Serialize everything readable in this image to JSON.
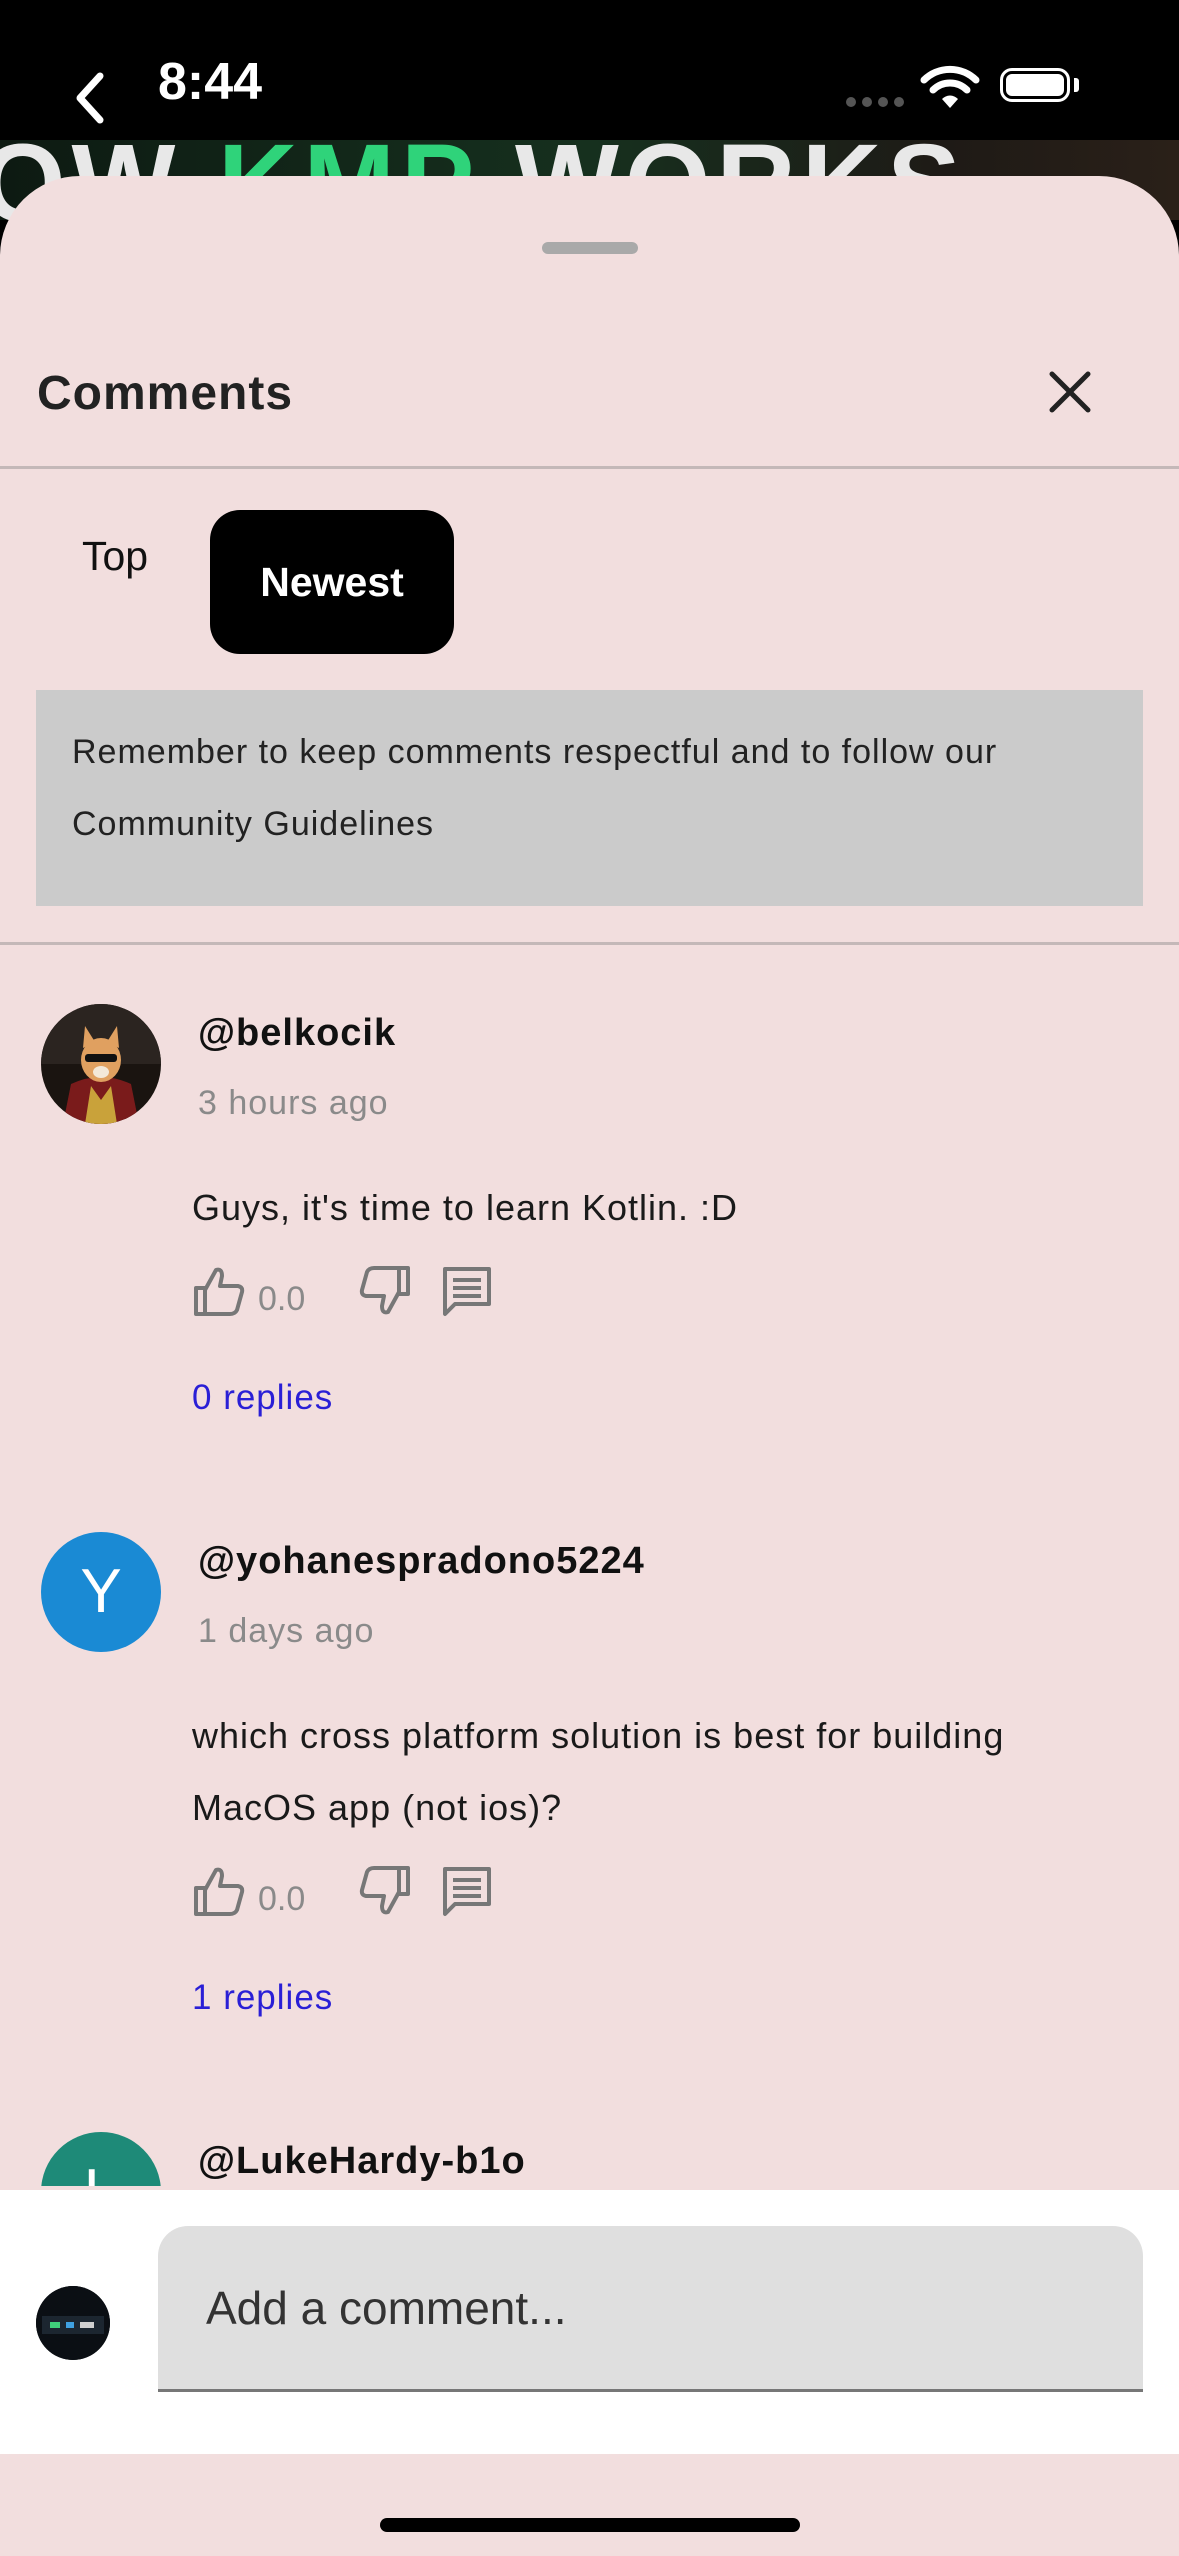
{
  "status_bar": {
    "time": "8:44"
  },
  "thumbnail": {
    "text_white_1": "OW ",
    "text_green": "KMP",
    "text_white_2": " WORKS"
  },
  "sheet": {
    "title": "Comments",
    "tabs": [
      {
        "label": "Top",
        "selected": false
      },
      {
        "label": "Newest",
        "selected": true
      }
    ],
    "notice": "Remember to keep comments respectful and to follow our Community Guidelines"
  },
  "comments": [
    {
      "author": "@belkocik",
      "time": "3 hours ago",
      "text": "Guys, it's time to learn Kotlin. :D",
      "likes": "0.0",
      "replies": "0 replies"
    },
    {
      "author": "@yohanespradono5224",
      "avatar_letter": "Y",
      "avatar_color": "#1a8ad4",
      "time": "1 days ago",
      "text": "which cross platform solution is best for building MacOS app (not ios)?",
      "likes": "0.0",
      "replies": "1 replies"
    },
    {
      "author": "@LukeHardy-b1o",
      "avatar_letter": "L",
      "avatar_color": "#1e8a78"
    }
  ],
  "input": {
    "placeholder": "Add a comment..."
  },
  "colors": {
    "sheet_bg": "#f2dede",
    "selected_tab": "#000000",
    "reply_link": "#2a1fd6",
    "notice_bg": "#cbcbcb"
  }
}
